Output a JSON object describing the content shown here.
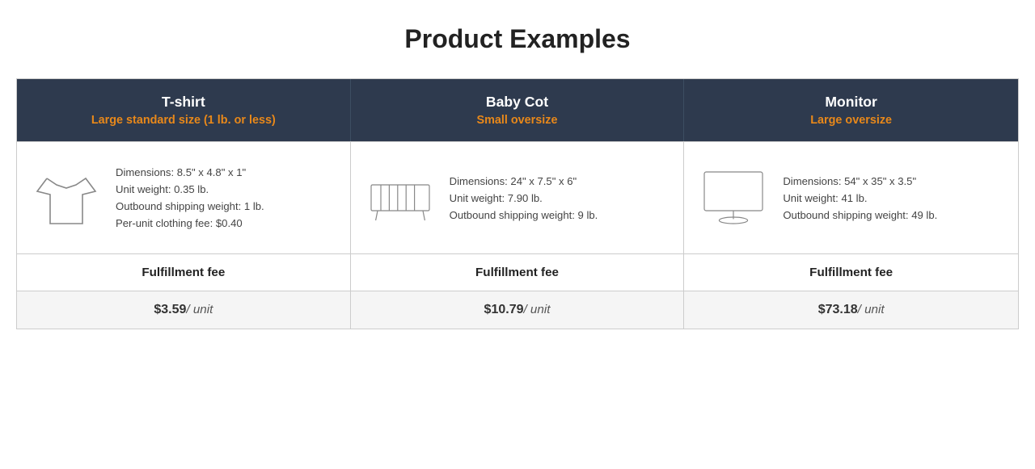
{
  "page": {
    "title": "Product Examples"
  },
  "columns": [
    {
      "id": "tshirt",
      "product_name": "T-shirt",
      "product_size": "Large standard size (1 lb. or less)",
      "dimensions": "Dimensions: 8.5\" x 4.8\" x 1\"",
      "unit_weight": "Unit weight: 0.35 lb.",
      "outbound_shipping": "Outbound shipping weight: 1 lb.",
      "extra_fee": "Per-unit clothing fee: $0.40",
      "fulfillment_label": "Fulfillment fee",
      "fee_amount": "$3.59",
      "fee_unit": "/ unit"
    },
    {
      "id": "baby-cot",
      "product_name": "Baby Cot",
      "product_size": "Small oversize",
      "dimensions": "Dimensions: 24\" x 7.5\" x 6\"",
      "unit_weight": "Unit weight: 7.90 lb.",
      "outbound_shipping": "Outbound shipping weight: 9 lb.",
      "extra_fee": "",
      "fulfillment_label": "Fulfillment fee",
      "fee_amount": "$10.79",
      "fee_unit": "/ unit"
    },
    {
      "id": "monitor",
      "product_name": "Monitor",
      "product_size": "Large oversize",
      "dimensions": "Dimensions: 54\" x 35\" x 3.5\"",
      "unit_weight": "Unit weight: 41 lb.",
      "outbound_shipping": "Outbound shipping weight: 49 lb.",
      "extra_fee": "",
      "fulfillment_label": "Fulfillment fee",
      "fee_amount": "$73.18",
      "fee_unit": "/ unit"
    }
  ]
}
